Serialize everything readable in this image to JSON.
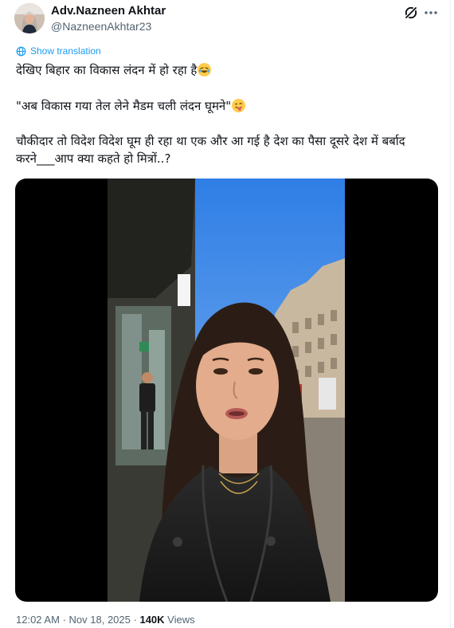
{
  "author": {
    "name": "Adv.Nazneen Akhtar",
    "handle": "@NazneenAkhtar23"
  },
  "translate_label": "Show translation",
  "body": {
    "line1": "देखिए बिहार का विकास लंदन में हो रहा है",
    "line2": "\"अब विकास गया तेल लेने मैडम चली लंदन घूमने\"",
    "line3": "चौकीदार तो विदेश विदेश घूम ही रहा था एक और आ गई है देश का पैसा दूसरे देश में बर्बाद करने___आप क्या कहते हो मित्रों..?"
  },
  "meta": {
    "time": "12:02 AM",
    "separator": "·",
    "date": "Nov 18, 2025",
    "views_count": "140K",
    "views_label": "Views"
  },
  "icons": [
    "grok-icon",
    "more-icon",
    "translate-globe-icon",
    "rofl-emoji-icon",
    "winking-tongue-emoji-icon"
  ],
  "colors": {
    "link": "#1d9bf0",
    "secondary": "#536471",
    "text": "#0f1419"
  }
}
